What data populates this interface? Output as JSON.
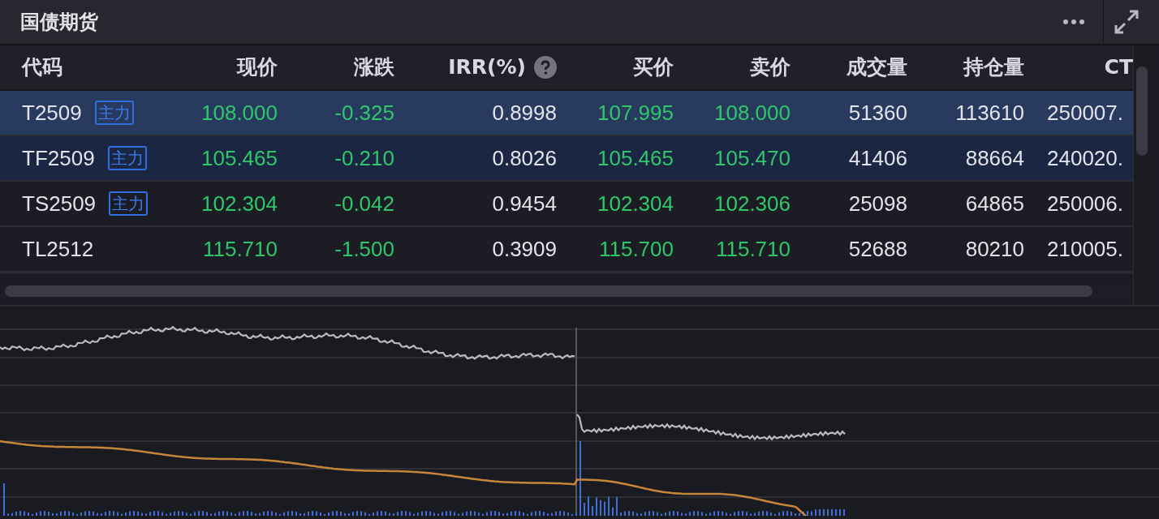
{
  "panel": {
    "title": "国债期货"
  },
  "table": {
    "columns": [
      {
        "label": "代码",
        "help": false
      },
      {
        "label": "现价",
        "help": false
      },
      {
        "label": "涨跌",
        "help": false
      },
      {
        "label": "IRR(%)",
        "help": true
      },
      {
        "label": "买价",
        "help": false
      },
      {
        "label": "卖价",
        "help": false
      },
      {
        "label": "成交量",
        "help": false
      },
      {
        "label": "持仓量",
        "help": false
      },
      {
        "label": "CT",
        "help": false
      }
    ],
    "rows": [
      {
        "tag": "主力",
        "selected": true,
        "hovered": false,
        "cells": [
          "T2509",
          "108.000",
          "-0.325",
          "0.8998",
          "107.995",
          "108.000",
          "51360",
          "113610",
          "250007."
        ]
      },
      {
        "tag": "主力",
        "selected": false,
        "hovered": true,
        "cells": [
          "TF2509",
          "105.465",
          "-0.210",
          "0.8026",
          "105.465",
          "105.470",
          "41406",
          "88664",
          "240020."
        ]
      },
      {
        "tag": "主力",
        "selected": false,
        "hovered": false,
        "cells": [
          "TS2509",
          "102.304",
          "-0.042",
          "0.9454",
          "102.304",
          "102.306",
          "25098",
          "64865",
          "250006."
        ]
      },
      {
        "selected": false,
        "hovered": false,
        "cells": [
          "TL2512",
          "115.710",
          "-1.500",
          "0.3909",
          "115.700",
          "115.710",
          "52688",
          "80210",
          "210005."
        ]
      }
    ]
  }
}
